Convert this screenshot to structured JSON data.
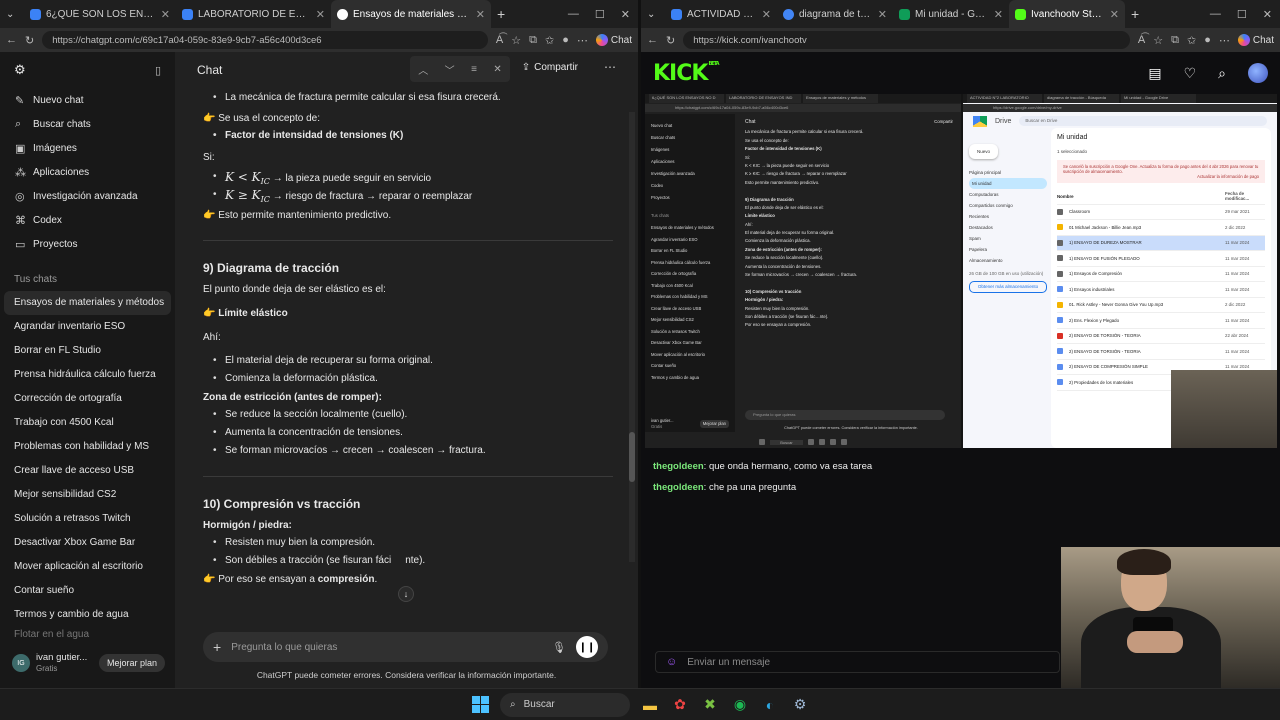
{
  "left_browser": {
    "tabs": [
      {
        "title": "6¿QUÉ SON LOS ENSAYOS NO D",
        "color": "#3b82f6"
      },
      {
        "title": "LABORATORIO DE ENSAYOS IND",
        "color": "#3b82f6"
      },
      {
        "title": "Ensayos de materiales y métodos",
        "color": "#ffffff",
        "active": true
      }
    ],
    "url": "https://chatgpt.com/c/69c17a04-059c-83e9-9cb7-a56c400d3ce6",
    "chat_button": "Chat"
  },
  "right_browser": {
    "tabs": [
      {
        "title": "ACTIVIDAD N°2 LABO",
        "color": "#3b82f6"
      },
      {
        "title": "diagrama de tracción",
        "color": "#4285f4"
      },
      {
        "title": "Mi unidad - Google D",
        "color": "#0f9d58"
      },
      {
        "title": "Ivanchootv Stream - V",
        "color": "#53fc18",
        "active": true
      }
    ],
    "url": "https://kick.com/ivanchootv",
    "chat_button": "Chat"
  },
  "chatgpt": {
    "sidebar": {
      "nav": [
        {
          "label": "Nuevo chat",
          "icon": "new-chat-icon",
          "glyph": "✎"
        },
        {
          "label": "Buscar chats",
          "icon": "search-icon",
          "glyph": "⌕"
        },
        {
          "label": "Imágenes",
          "icon": "images-icon",
          "glyph": "▣"
        },
        {
          "label": "Aplicaciones",
          "icon": "apps-icon",
          "glyph": "⁂"
        },
        {
          "label": "Investigación avanzada",
          "icon": "research-icon",
          "glyph": "◎"
        },
        {
          "label": "Codex",
          "icon": "codex-icon",
          "glyph": "⌘"
        },
        {
          "label": "Proyectos",
          "icon": "folder-icon",
          "glyph": "▭"
        }
      ],
      "section_title": "Tus chats",
      "chats": [
        "Ensayos de materiales y métodos",
        "Agrandar inventario ESO",
        "Borrar en FL Studio",
        "Prensa hidráulica cálculo fuerza",
        "Corrección de ortografía",
        "Trabajo con 4500 Kcal",
        "Problemas con habilidad y MS",
        "Crear llave de acceso USB",
        "Mejor sensibilidad CS2",
        "Solución a retrasos Twitch",
        "Desactivar Xbox Game Bar",
        "Mover aplicación al escritorio",
        "Contar sueño",
        "Termos y cambio de agua",
        "Flotar en el agua"
      ],
      "user_name": "ivan gutier...",
      "user_initials": "IG",
      "user_plan": "Gratis",
      "upgrade_label": "Mejorar plan"
    },
    "header": {
      "title": "Chat",
      "share_label": "Compartir"
    },
    "content": {
      "l1": "La mecánica de fractura permite calcular si esa fisura crecerá.",
      "l2": "Se usa el concepto de:",
      "l3": "Factor de intensidad de tensiones (K)",
      "l4": "Si:",
      "l5_math": "K < K",
      "l5_sub": "IC",
      "l5_text": "→ la pieza puede seguir en servicio",
      "l6_math": "K ≥ K",
      "l6_sub": "IC",
      "l6_text": "→ riesgo de fractura → reparar o reemplazar",
      "l7": "Esto permite mantenimiento predictivo.",
      "h9": "9) Diagrama de tracción",
      "p9": "El punto donde deja de ser elástico es el:",
      "p9b": "Límite elástico",
      "ahi": "Ahí:",
      "b1": "El material deja de recuperar su forma original.",
      "b2": "Comienza la deformación plástica.",
      "zona": "Zona de estricción (antes de romper):",
      "b3": "Se reduce la sección localmente (cuello).",
      "b4": "Aumenta la concentración de tensiones.",
      "b5": "Se forman microvacíos → crecen → coalescen → fractura.",
      "h10": "10) Compresión vs tracción",
      "horm": "Hormigón / piedra:",
      "b6": "Resisten muy bien la compresión.",
      "b7": "Son débiles a tracción (se fisuran fáci",
      "b7end": "nte).",
      "last_pre": "Por eso se ensayan a ",
      "last_b": "compresión",
      "last_post": "."
    },
    "input_placeholder": "Pregunta lo que quieras",
    "disclaimer": "ChatGPT puede cometer errores. Considera verificar la información importante."
  },
  "kick": {
    "logo": "KICK",
    "beta": "BETA",
    "chat": [
      {
        "user": "thegoldeen",
        "text": "que onda hermano, como va esa tarea"
      },
      {
        "user": "thegoldeen",
        "text": "che pa una pregunta"
      }
    ],
    "input_placeholder": "Enviar un mensaje",
    "username_color": "#7be87b"
  },
  "stream_preview": {
    "left_tabs": [
      "6¿QUÉ SON LOS ENSAYOS NO D",
      "LABORATORIO DE ENSAYOS IND",
      "Ensayos de materiales y métodos"
    ],
    "right_tabs": [
      "ACTIVIDAD N°2 LABORATORIO",
      "diagrama de tracción - Búsqueda",
      "Mi unidad - Google Drive"
    ],
    "left_url": "https://chatgpt.com/c/69c17a04-059c-83e9-9cb7-a56c400d3ce6",
    "right_url": "https://drive.google.com/drive/my-drive",
    "side_nav": [
      "Nuevo chat",
      "Buscar chats",
      "Imágenes",
      "Aplicaciones",
      "Investigación avanzada",
      "Codex",
      "Proyectos"
    ],
    "side_section": "Tus chats",
    "side_chats": [
      "Ensayos de materiales y métodos",
      "Agrandar inventario ESO",
      "Borrar en FL Studio",
      "Prensa hidráulica cálculo fuerza",
      "Corrección de ortografía",
      "Trabajo con 4500 Kcal",
      "Problemas con habilidad y MS",
      "Crear llave de acceso USB",
      "Mejor sensibilidad CS2",
      "Solución a retrasos Twitch",
      "Desactivar Xbox Game Bar",
      "Mover aplicación al escritorio",
      "Contar sueño",
      "Termos y cambio de agua"
    ],
    "side_user": "ivan gutier...",
    "side_plan": "Gratis",
    "side_upgrade": "Mejorar plan",
    "chat_title": "Chat",
    "chat_share": "Compartir",
    "chat_lines": [
      {
        "t": "La mecánica de fractura permite calcular si esa fisura crecerá.",
        "b": false
      },
      {
        "t": "Se usa el concepto de:",
        "b": false
      },
      {
        "t": "Factor de intensidad de tensiones (K)",
        "b": true
      },
      {
        "t": "Si:",
        "b": false
      },
      {
        "t": "K < KIC → la pieza puede seguir en servicio",
        "b": false
      },
      {
        "t": "K ≥ KIC → riesgo de fractura → reparar o reemplazar",
        "b": false
      },
      {
        "t": "Esto permite mantenimiento predictivo.",
        "b": false
      },
      {
        "t": "",
        "b": false
      },
      {
        "t": "9) Diagrama de tracción",
        "b": true
      },
      {
        "t": "El punto donde deja de ser elástico es el:",
        "b": false
      },
      {
        "t": "Límite elástico",
        "b": true
      },
      {
        "t": "Ahí:",
        "b": false
      },
      {
        "t": "El material deja de recuperar su forma original.",
        "b": false
      },
      {
        "t": "Comienza la deformación plástica.",
        "b": false
      },
      {
        "t": "Zona de estricción (antes de romper):",
        "b": true
      },
      {
        "t": "Se reduce la sección localmente (cuello).",
        "b": false
      },
      {
        "t": "Aumenta la concentración de tensiones.",
        "b": false
      },
      {
        "t": "Se forman microvacíos → crecen → coalescen → fractura.",
        "b": false
      },
      {
        "t": "",
        "b": false
      },
      {
        "t": "10) Compresión vs tracción",
        "b": true
      },
      {
        "t": "Hormigón / piedra:",
        "b": true
      },
      {
        "t": "Resisten muy bien la compresión.",
        "b": false
      },
      {
        "t": "Son débiles a tracción (se fisuran fác…nte).",
        "b": false
      },
      {
        "t": "Por eso se ensayan a compresión.",
        "b": false
      }
    ],
    "chat_input": "Pregunta lo que quieras",
    "chat_disclaimer": "ChatGPT puede cometer errores. Considera verificar la información importante.",
    "drive_name": "Drive",
    "drive_search": "Buscar en Drive",
    "drive_new": "Nuevo",
    "drive_side": [
      "Página principal",
      "Mi unidad",
      "Computadoras",
      "Compartidos conmigo",
      "Recientes",
      "Destacados",
      "Spam",
      "Papelera",
      "Almacenamiento"
    ],
    "drive_storage": "26 GB de 100 GB en uso (utilización)",
    "drive_storage_btn": "Obtener más almacenamiento",
    "drive_title": "Mi unidad",
    "drive_selected": "1 seleccionado",
    "drive_alert": "Se canceló la suscripción a Google One. Actualiza tu forma de pago antes del 4 abr 2026 para renovar tu suscripción de almacenamiento.",
    "drive_alert_action": "Actualizar la información de pago",
    "drive_col_name": "Nombre",
    "drive_col_date": "Fecha de modificac...",
    "drive_files": [
      {
        "name": "Classroom",
        "date": "29 mar 2021",
        "kind": "folder"
      },
      {
        "name": "01 Michael Jackson - Billie Jean.mp3",
        "date": "2 dic 2022",
        "kind": "file"
      },
      {
        "name": "1) ENSAYO DE DUREZA MOSTRAR",
        "date": "11 mar 2024",
        "kind": "folder",
        "hl": true
      },
      {
        "name": "1) ENSAYO DE FUSIÓN PLEGADO",
        "date": "11 mar 2024",
        "kind": "folder"
      },
      {
        "name": "1) Ensayos de Compresión",
        "date": "11 mar 2024",
        "kind": "folder"
      },
      {
        "name": "1) Ensayos industriales",
        "date": "11 mar 2024",
        "kind": "doc"
      },
      {
        "name": "01. Rick Astley - Never Gonna Give You Up.mp3",
        "date": "2 dic 2022",
        "kind": "file"
      },
      {
        "name": "2) Ens. Flexion y Plegado",
        "date": "11 mar 2024",
        "kind": "doc"
      },
      {
        "name": "2) ENSAYO DE TORSIÓN - TEORIA",
        "date": "22 abr 2024",
        "kind": "pdf"
      },
      {
        "name": "2) ENSAYO DE TORSIÓN - TEORIA",
        "date": "11 mar 2024",
        "kind": "doc"
      },
      {
        "name": "2) ENSAYO DE COMPRESIÓN SIMPLE",
        "date": "11 mar 2024",
        "kind": "doc"
      },
      {
        "name": "2) Propiedades de los materiales",
        "date": "11 mar 2024",
        "kind": "doc"
      }
    ],
    "taskbar_search": "Buscar"
  },
  "taskbar": {
    "search_label": "Buscar"
  }
}
